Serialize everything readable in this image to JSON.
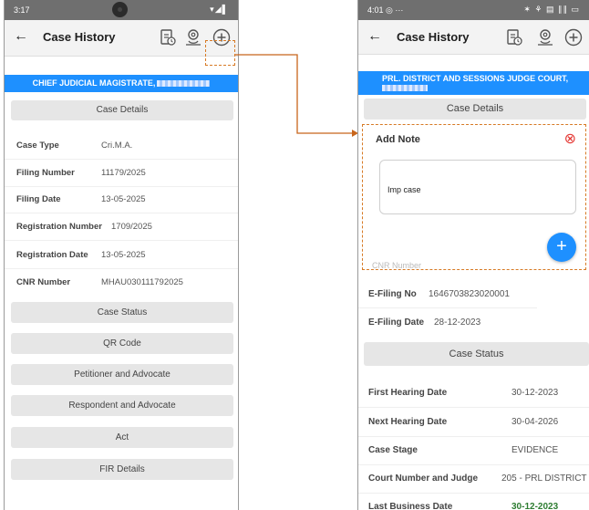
{
  "left_screen": {
    "status": {
      "time": "3:17",
      "icons": "▾◢▌"
    },
    "header": {
      "title": "Case History"
    },
    "court_name": "CHIEF JUDICIAL MAGISTRATE,",
    "case_details_label": "Case Details",
    "details": [
      {
        "label": "Case Type",
        "value": "Cri.M.A."
      },
      {
        "label": "Filing Number",
        "value": "11179/2025"
      },
      {
        "label": "Filing Date",
        "value": "13-05-2025"
      },
      {
        "label": "Registration Number",
        "value": "1709/2025"
      },
      {
        "label": "Registration Date",
        "value": "13-05-2025"
      },
      {
        "label": "CNR Number",
        "value": "MHAU030111792025"
      }
    ],
    "sections": [
      "Case Status",
      "QR Code",
      "Petitioner and Advocate",
      "Respondent and Advocate",
      "Act",
      "FIR Details"
    ]
  },
  "right_screen": {
    "status": {
      "time": "4:01",
      "extra": "◎ ···",
      "icons": "✶ ⚘ ▤ ∥∥ ▭"
    },
    "header": {
      "title": "Case History"
    },
    "court_name": "PRL. DISTRICT AND SESSIONS JUDGE COURT,",
    "case_details_label": "Case Details",
    "add_note": {
      "title": "Add Note",
      "text": "Imp case",
      "add_symbol": "+",
      "close_symbol": "⊗"
    },
    "hidden_row_label": "CNR Number",
    "efiling": [
      {
        "label": "E-Filing No",
        "value": "1646703823020001"
      },
      {
        "label": "E-Filing Date",
        "value": "28-12-2023"
      }
    ],
    "case_status_label": "Case Status",
    "status_rows": [
      {
        "label": "First Hearing Date",
        "value": "30-12-2023"
      },
      {
        "label": "Next Hearing Date",
        "value": "30-04-2026"
      },
      {
        "label": "Case Stage",
        "value": "EVIDENCE"
      },
      {
        "label": "Court Number and Judge",
        "value": "205 - PRL DISTRICT"
      },
      {
        "label": "Last Business Date",
        "value": "30-12-2023"
      }
    ]
  },
  "colors": {
    "accent": "#1e90ff",
    "highlight": "#d77a25",
    "close": "#e53935",
    "green": "#2e7d32"
  }
}
